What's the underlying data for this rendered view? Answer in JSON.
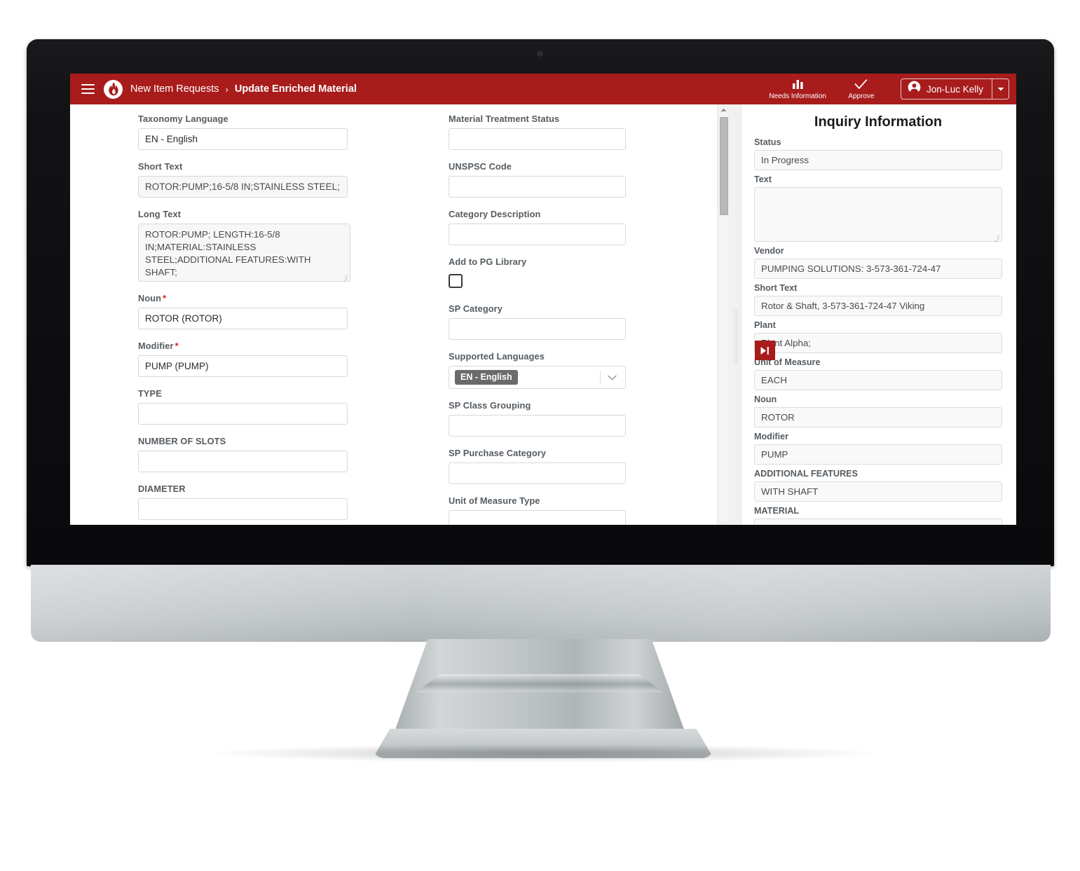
{
  "appbar": {
    "menu_icon": "hamburger-icon",
    "logo_icon": "flame-logo-icon",
    "breadcrumb_root": "New Item Requests",
    "breadcrumb_separator": "›",
    "breadcrumb_current": "Update Enriched Material",
    "actions": [
      {
        "icon": "bar-chart-icon",
        "label": "Needs Information"
      },
      {
        "icon": "check-icon",
        "label": "Approve"
      }
    ],
    "user": {
      "avatar_icon": "user-avatar-icon",
      "name": "Jon-Luc Kelly",
      "caret_icon": "caret-down-icon"
    },
    "bar_color": "#a81c1c"
  },
  "form": {
    "column_left": [
      {
        "label": "Taxonomy Language",
        "value": "EN - English",
        "required": false,
        "readonly": false,
        "type": "text"
      },
      {
        "label": "Short Text",
        "value": "ROTOR:PUMP;16-5/8 IN;STAINLESS STEEL;",
        "required": false,
        "readonly": true,
        "type": "text"
      },
      {
        "label": "Long Text",
        "value": "ROTOR:PUMP; LENGTH:16-5/8 IN;MATERIAL:STAINLESS STEEL;ADDITIONAL FEATURES:WITH SHAFT;",
        "required": false,
        "readonly": true,
        "type": "textarea"
      },
      {
        "label": "Noun",
        "value": "ROTOR (ROTOR)",
        "required": true,
        "readonly": false,
        "type": "text"
      },
      {
        "label": "Modifier",
        "value": "PUMP (PUMP)",
        "required": true,
        "readonly": false,
        "type": "text"
      },
      {
        "label": "TYPE",
        "value": "",
        "required": false,
        "readonly": false,
        "type": "text"
      },
      {
        "label": "NUMBER OF SLOTS",
        "value": "",
        "required": false,
        "readonly": false,
        "type": "text"
      },
      {
        "label": "DIAMETER",
        "value": "",
        "required": false,
        "readonly": false,
        "type": "text"
      }
    ],
    "column_middle": [
      {
        "label": "Material Treatment Status",
        "value": "",
        "required": false,
        "readonly": false,
        "type": "text"
      },
      {
        "label": "UNSPSC Code",
        "value": "",
        "required": false,
        "readonly": false,
        "type": "text"
      },
      {
        "label": "Category Description",
        "value": "",
        "required": false,
        "readonly": false,
        "type": "text"
      },
      {
        "label": "Add to PG Library",
        "value": "",
        "required": false,
        "readonly": false,
        "type": "checkbox",
        "checked": false
      },
      {
        "label": "SP Category",
        "value": "",
        "required": false,
        "readonly": false,
        "type": "text"
      },
      {
        "label": "Supported Languages",
        "value": "EN - English",
        "required": false,
        "readonly": false,
        "type": "multiselect"
      },
      {
        "label": "SP Class Grouping",
        "value": "",
        "required": false,
        "readonly": false,
        "type": "text"
      },
      {
        "label": "SP Purchase Category",
        "value": "",
        "required": false,
        "readonly": false,
        "type": "text"
      },
      {
        "label": "Unit of Measure Type",
        "value": "",
        "required": false,
        "readonly": false,
        "type": "text"
      }
    ]
  },
  "inquiry": {
    "title": "Inquiry Information",
    "collapse_icon": "skip-forward-icon",
    "fields": [
      {
        "label": "Status",
        "value": "In Progress",
        "type": "text"
      },
      {
        "label": "Text",
        "value": "",
        "type": "textarea"
      },
      {
        "label": "Vendor",
        "value": "PUMPING SOLUTIONS: 3-573-361-724-47",
        "type": "text"
      },
      {
        "label": "Short Text",
        "value": "Rotor & Shaft, 3-573-361-724-47 Viking",
        "type": "text"
      },
      {
        "label": "Plant",
        "value": "Plant Alpha;",
        "type": "text"
      },
      {
        "label": "Unit of Measure",
        "value": "EACH",
        "type": "text"
      },
      {
        "label": "Noun",
        "value": "ROTOR",
        "type": "text"
      },
      {
        "label": "Modifier",
        "value": "PUMP",
        "type": "text"
      },
      {
        "label": "ADDITIONAL FEATURES",
        "value": "WITH SHAFT",
        "type": "text"
      },
      {
        "label": "MATERIAL",
        "value": "",
        "type": "text"
      }
    ]
  },
  "scrollbar": {
    "up_arrow_icon": "caret-up-icon"
  }
}
